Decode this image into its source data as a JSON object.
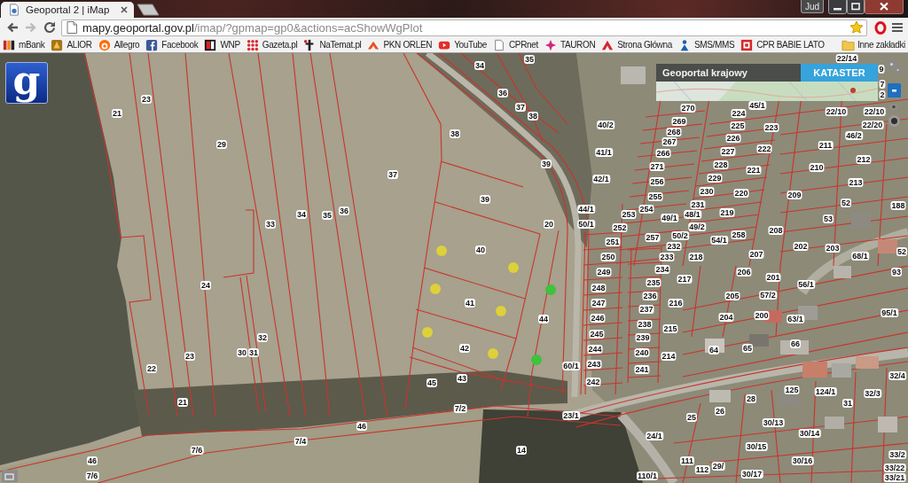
{
  "browser": {
    "tabs": [
      {
        "title": "Geoportal 2 | iMap",
        "selected": true
      }
    ],
    "profile": "Jud",
    "navigation": [
      {
        "kind": "back",
        "disabled": false
      },
      {
        "kind": "forward",
        "disabled": true
      },
      {
        "kind": "reload",
        "disabled": false
      }
    ],
    "address": {
      "host": "mapy.geoportal.gov.pl",
      "path": "/imap/?gpmap=gp0&actions=acShowWgPlot",
      "bookmarked": true
    },
    "bookmarks": [
      "mBank",
      "ALIOR",
      "Allegro",
      "Facebook",
      "WNP",
      "Gazeta.pl",
      "NaTemat.pl",
      "PKN ORLEN",
      "YouTube",
      "CPRnet",
      "TAURON",
      "Strona Główna",
      "SMS/MMS",
      "CPR BABIE LATO"
    ],
    "other_bookmarks": "Inne zakładki"
  },
  "map": {
    "logo": "g",
    "layer_tabs": [
      {
        "label": "Geoportal krajowy",
        "selected": false
      },
      {
        "label": "KATASTER",
        "selected": true
      }
    ],
    "parcels": [
      "35",
      "22/14",
      "34",
      "9",
      "7",
      "23",
      "36",
      "2",
      "37",
      "270",
      "45/1",
      "21",
      "38",
      "224",
      "22/10",
      "22/10",
      "40/2",
      "269",
      "225",
      "22/20",
      "38",
      "268",
      "226",
      "223",
      "46/2",
      "29",
      "267",
      "211",
      "41/1",
      "266",
      "227",
      "222",
      "39",
      "212",
      "271",
      "228",
      "210",
      "37",
      "221",
      "42/1",
      "256",
      "229",
      "213",
      "39",
      "255",
      "230",
      "220",
      "209",
      "231",
      "52",
      "188",
      "33",
      "34",
      "35",
      "36",
      "20",
      "44/1",
      "50/1",
      "253",
      "252",
      "254",
      "49/1",
      "48/1",
      "49/2",
      "219",
      "53",
      "40",
      "251",
      "250",
      "257",
      "50/2",
      "232",
      "233",
      "218",
      "54/1",
      "258",
      "207",
      "208",
      "202",
      "203",
      "68/1",
      "52",
      "249",
      "234",
      "206",
      "93",
      "217",
      "201",
      "24",
      "248",
      "235",
      "56/1",
      "236",
      "205",
      "57/2",
      "41",
      "247",
      "216",
      "44",
      "246",
      "237",
      "238",
      "215",
      "204",
      "200",
      "63/1",
      "95/1",
      "32",
      "245",
      "239",
      "42",
      "65",
      "66",
      "23",
      "30",
      "31",
      "244",
      "240",
      "214",
      "64",
      "22",
      "60/1",
      "243",
      "241",
      "43",
      "32/4",
      "45",
      "242",
      "125",
      "124/1",
      "32/3",
      "21",
      "7/2",
      "23/1",
      "25",
      "26",
      "28",
      "31",
      "46",
      "30/13",
      "24/1",
      "30/14",
      "7/4",
      "7/6",
      "14",
      "30/15",
      "46",
      "111",
      "30/16",
      "33/2",
      "112",
      "29/",
      "33/22",
      "7/6",
      "110/1",
      "30/17",
      "33/21"
    ],
    "markers": [
      {
        "color": "#ddd03a"
      },
      {
        "color": "#ddd03a"
      },
      {
        "color": "#ddd03a"
      },
      {
        "color": "#3fc23c"
      },
      {
        "color": "#ddd03a"
      },
      {
        "color": "#ddd03a"
      },
      {
        "color": "#ddd03a"
      },
      {
        "color": "#3fc23c"
      }
    ]
  }
}
